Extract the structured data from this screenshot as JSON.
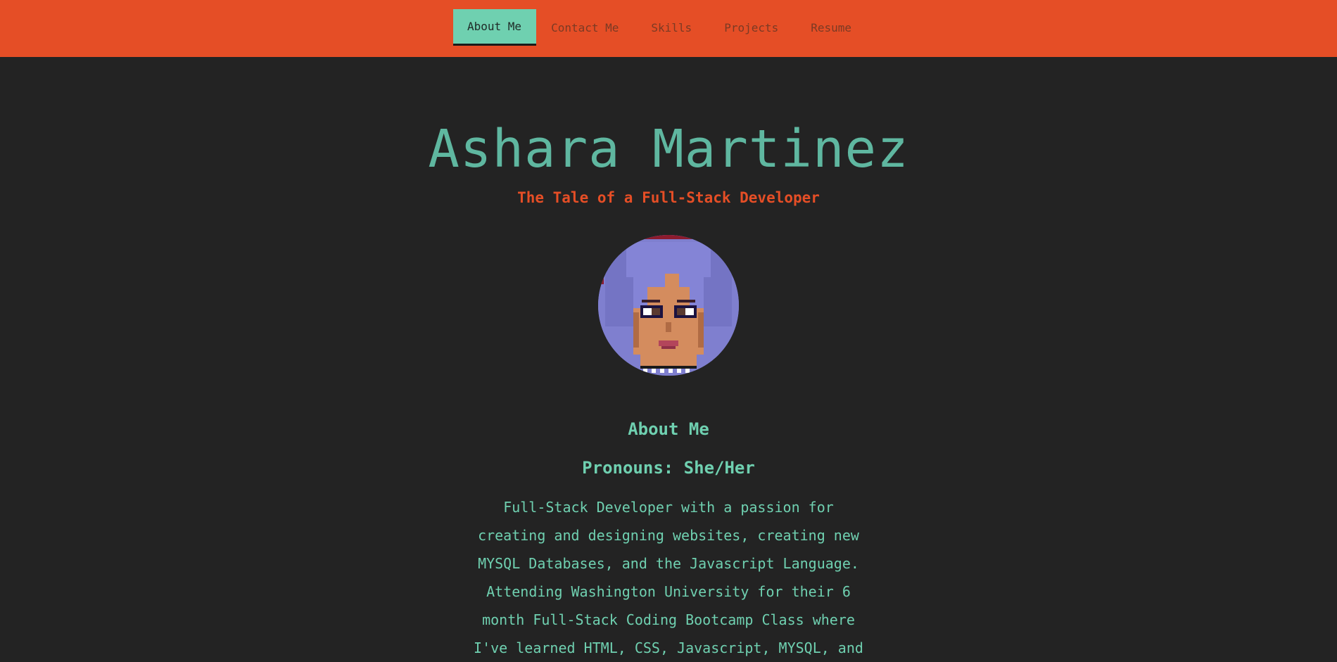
{
  "nav": {
    "tabs": [
      {
        "label": "About Me",
        "active": true
      },
      {
        "label": "Contact Me",
        "active": false
      },
      {
        "label": "Skills",
        "active": false
      },
      {
        "label": "Projects",
        "active": false
      },
      {
        "label": "Resume",
        "active": false
      }
    ]
  },
  "hero": {
    "name": "Ashara Martinez",
    "tagline": "The Tale of a Full-Stack Developer",
    "avatar_icon": "pixel-art-portrait"
  },
  "about": {
    "title": "About Me",
    "pronouns": "Pronouns: She/Her",
    "bio": "Full-Stack Developer with a passion for creating and designing websites, creating new MYSQL Databases, and the Javascript Language. Attending Washington University for their 6 month Full-Stack Coding Bootcamp Class where I've learned HTML, CSS, Javascript, MYSQL, and"
  },
  "colors": {
    "nav_bg": "#e54e26",
    "page_bg": "#232323",
    "accent": "#6fd0b0",
    "name": "#5fb7a0"
  }
}
